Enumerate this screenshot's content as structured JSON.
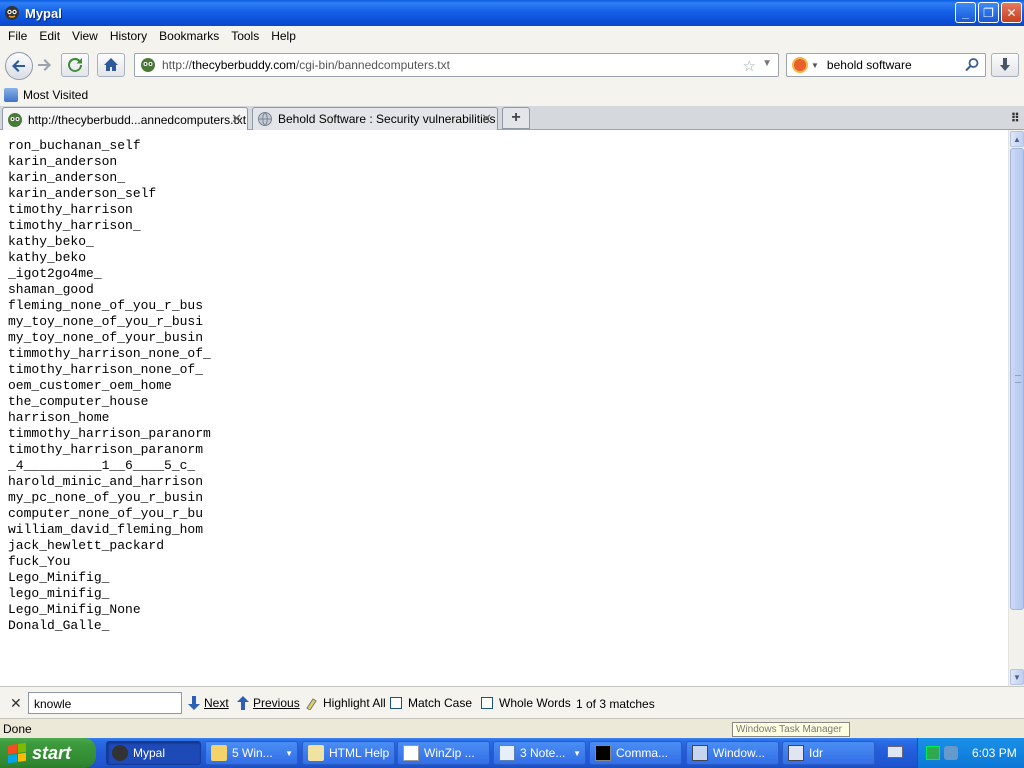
{
  "window": {
    "title": "Mypal"
  },
  "menu": [
    "File",
    "Edit",
    "View",
    "History",
    "Bookmarks",
    "Tools",
    "Help"
  ],
  "nav": {
    "url_prefix": "http://",
    "url_host": "thecyberbuddy.com",
    "url_path": "/cgi-bin/bannedcomputers.txt",
    "search_value": "behold software"
  },
  "bookmarks": {
    "most_visited": "Most Visited"
  },
  "tabs": [
    {
      "label": "http://thecyberbudd...annedcomputers.txt",
      "active": true
    },
    {
      "label": "Behold Software : Security vulnerabilities",
      "active": false
    }
  ],
  "content": {
    "lines": [
      "ron_buchanan_self",
      "karin_anderson",
      "karin_anderson_",
      "karin_anderson_self",
      "timothy_harrison",
      "timothy_harrison_",
      "kathy_beko_",
      "kathy_beko",
      "_igot2go4me_",
      "shaman_good",
      "fleming_none_of_you_r_bus",
      "my_toy_none_of_you_r_busi",
      "my_toy_none_of_your_busin",
      "timmothy_harrison_none_of_",
      "timothy_harrison_none_of_",
      "oem_customer_oem_home",
      "the_computer_house",
      "harrison_home",
      "timmothy_harrison_paranorm",
      "timothy_harrison_paranorm",
      "_4__________1__6____5_c_",
      "harold_minic_and_harrison",
      "my_pc_none_of_you_r_busin",
      "computer_none_of_you_r_bu",
      "william_david_fleming_hom",
      "jack_hewlett_packard",
      "fuck_You",
      "Lego_Minifig_",
      "lego_minifig_",
      "Lego_Minifig_None",
      "Donald_Galle_"
    ]
  },
  "findbar": {
    "query": "knowle",
    "next": "Next",
    "previous": "Previous",
    "highlight_all": "Highlight All",
    "match_case": "Match Case",
    "whole_words": "Whole Words",
    "status": "1 of 3 matches"
  },
  "statusbar": {
    "text": "Done",
    "tooltip": "Windows Task Manager"
  },
  "taskbar": {
    "start": "start",
    "buttons": [
      {
        "label": "Mypal",
        "icon": "mypal-icon",
        "active": true
      },
      {
        "label": "5 Win...",
        "icon": "folder-icon",
        "active": false,
        "group": true
      },
      {
        "label": "HTML Help",
        "icon": "help-icon",
        "active": false
      },
      {
        "label": "WinZip ...",
        "icon": "winzip-icon",
        "active": false
      },
      {
        "label": "3 Note...",
        "icon": "notepad-icon",
        "active": false,
        "group": true
      },
      {
        "label": "Comma...",
        "icon": "cmd-icon",
        "active": false
      },
      {
        "label": "Window...",
        "icon": "taskmgr-icon",
        "active": false
      },
      {
        "label": "Idr",
        "icon": "app-icon",
        "active": false
      }
    ],
    "clock": "6:03 PM"
  },
  "colors": {
    "titlebar": "#0b4fd6",
    "taskbar": "#245edb",
    "start": "#3c9a3c"
  }
}
